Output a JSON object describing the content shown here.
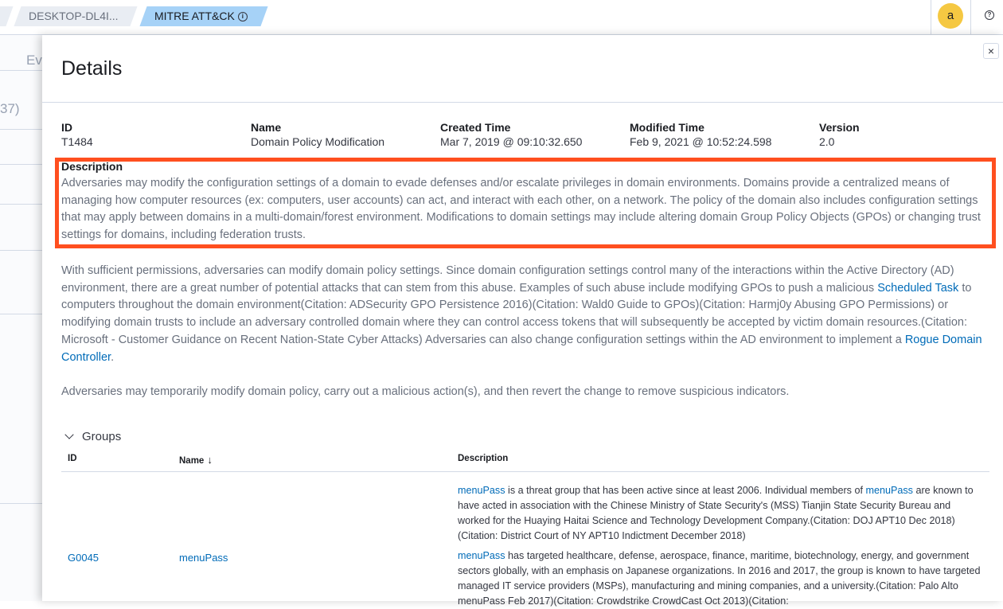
{
  "breadcrumbs": [
    {
      "label": "DESKTOP-DL4I..."
    },
    {
      "label": "MITRE ATT&CK"
    }
  ],
  "header": {
    "avatar_initial": "a",
    "help_glyph": "?"
  },
  "background": {
    "tab_fragment": "Ev",
    "count_fragment": "37)"
  },
  "flyout": {
    "title": "Details",
    "close_glyph": "×",
    "fields": [
      {
        "label": "ID",
        "value": "T1484"
      },
      {
        "label": "Name",
        "value": "Domain Policy Modification"
      },
      {
        "label": "Created Time",
        "value": "Mar 7, 2019 @ 09:10:32.650"
      },
      {
        "label": "Modified Time",
        "value": "Feb 9, 2021 @ 10:52:24.598"
      },
      {
        "label": "Version",
        "value": "2.0"
      }
    ],
    "description": {
      "label": "Description",
      "text": "Adversaries may modify the configuration settings of a domain to evade defenses and/or escalate privileges in domain environments. Domains provide a centralized means of managing how computer resources (ex: computers, user accounts) can act, and interact with each other, on a network. The policy of the domain also includes configuration settings that may apply between domains in a multi-domain/forest environment. Modifications to domain settings may include altering domain Group Policy Objects (GPOs) or changing trust settings for domains, including federation trusts."
    },
    "paragraph2": {
      "part1": "With sufficient permissions, adversaries can modify domain policy settings. Since domain configuration settings control many of the interactions within the Active Directory (AD) environment, there are a great number of potential attacks that can stem from this abuse. Examples of such abuse include modifying GPOs to push a malicious ",
      "link1": "Scheduled Task",
      "part2": " to computers throughout the domain environment(Citation: ADSecurity GPO Persistence 2016)(Citation: Wald0 Guide to GPOs)(Citation: Harmj0y Abusing GPO Permissions) or modifying domain trusts to include an adversary controlled domain where they can control access tokens that will subsequently be accepted by victim domain resources.(Citation: Microsoft - Customer Guidance on Recent Nation-State Cyber Attacks) Adversaries can also change configuration settings within the AD environment to implement a ",
      "link2": "Rogue Domain Controller",
      "part3": "."
    },
    "paragraph3": "Adversaries may temporarily modify domain policy, carry out a malicious action(s), and then revert the change to remove suspicious indicators.",
    "groups": {
      "title": "Groups",
      "columns": {
        "id": "ID",
        "name": "Name",
        "description": "Description"
      },
      "rows": [
        {
          "id": "G0045",
          "name": "menuPass",
          "desc1_link": "menuPass",
          "desc1_a": " is a threat group that has been active since at least 2006. Individual members of ",
          "desc1_link2": "menuPass",
          "desc1_b": " are known to have acted in association with the Chinese Ministry of State Security's (MSS) Tianjin State Security Bureau and worked for the Huaying Haitai Science and Technology Development Company.(Citation: DOJ APT10 Dec 2018)(Citation: District Court of NY APT10 Indictment December 2018)",
          "desc2_link": "menuPass",
          "desc2_a": " has targeted healthcare, defense, aerospace, finance, maritime, biotechnology, energy, and government sectors globally, with an emphasis on Japanese organizations. In 2016 and 2017, the group is known to have targeted managed IT service providers (MSPs), manufacturing and mining companies, and a university.(Citation: Palo Alto menuPass Feb 2017)(Citation: Crowdstrike CrowdCast Oct 2013)(Citation:"
        }
      ]
    }
  }
}
